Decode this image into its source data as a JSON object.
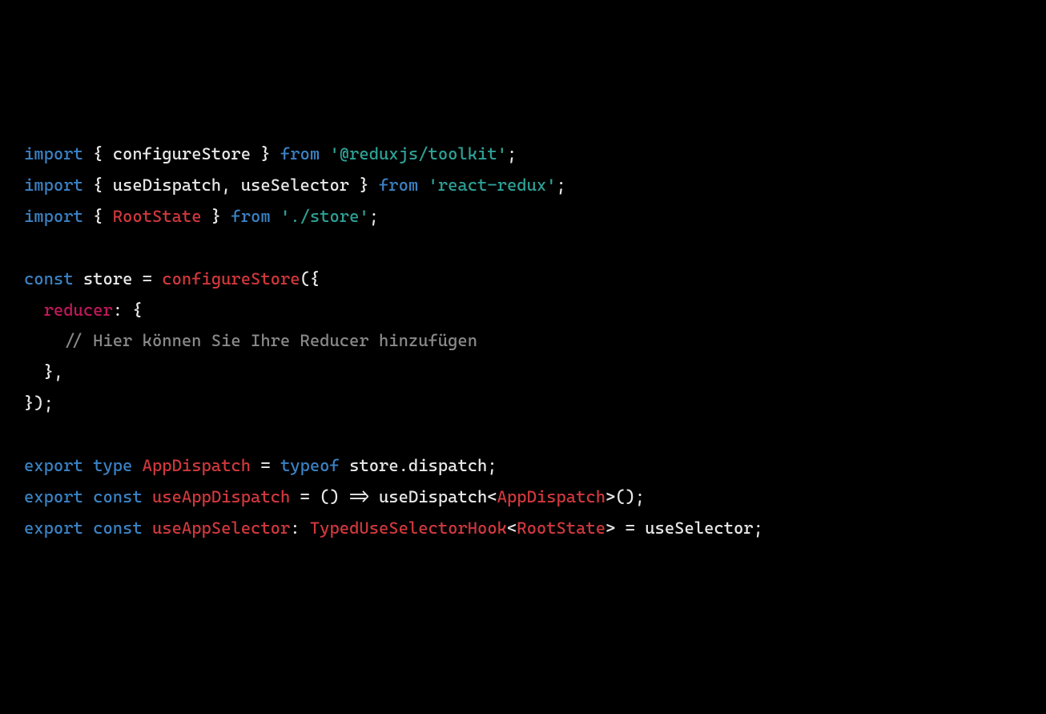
{
  "code": {
    "l1": {
      "import": "import",
      "brace_open": " { ",
      "name": "configureStore",
      "brace_close": " } ",
      "from": "from",
      "sp": " ",
      "str": "'@reduxjs/toolkit'",
      "semi": ";"
    },
    "l2": {
      "import": "import",
      "brace_open": " { ",
      "name": "useDispatch, useSelector",
      "brace_close": " } ",
      "from": "from",
      "sp": " ",
      "str": "'react-redux'",
      "semi": ";"
    },
    "l3": {
      "import": "import",
      "brace_open": " { ",
      "name": "RootState",
      "brace_close": " } ",
      "from": "from",
      "sp": " ",
      "str": "'./store'",
      "semi": ";"
    },
    "l4": " ",
    "l5": {
      "const": "const",
      "sp1": " ",
      "name": "store",
      "sp2": " = ",
      "func": "configureStore",
      "open": "({"
    },
    "l6": {
      "indent": "  ",
      "prop": "reducer",
      "rest": ": {"
    },
    "l7": {
      "indent": "    ",
      "comment": "// Hier können Sie Ihre Reducer hinzufügen"
    },
    "l8": "  },",
    "l9": "});",
    "l10": " ",
    "l11": {
      "export": "export",
      "sp1": " ",
      "type": "type",
      "sp2": " ",
      "name": "AppDispatch",
      "sp3": " = ",
      "typeof": "typeof",
      "sp4": " ",
      "rest": "store.dispatch;"
    },
    "l12": {
      "export": "export",
      "sp1": " ",
      "const": "const",
      "sp2": " ",
      "name": "useAppDispatch",
      "sp3": " = () => useDispatch<",
      "type": "AppDispatch",
      "rest": ">();"
    },
    "l13": {
      "export": "export",
      "sp1": " ",
      "const": "const",
      "sp2": " ",
      "name": "useAppSelector",
      "sp3": ": ",
      "hook": "TypedUseSelectorHook",
      "lt": "<",
      "rs": "RootState",
      "gt": ">",
      "rest": " = useSelector;"
    }
  }
}
